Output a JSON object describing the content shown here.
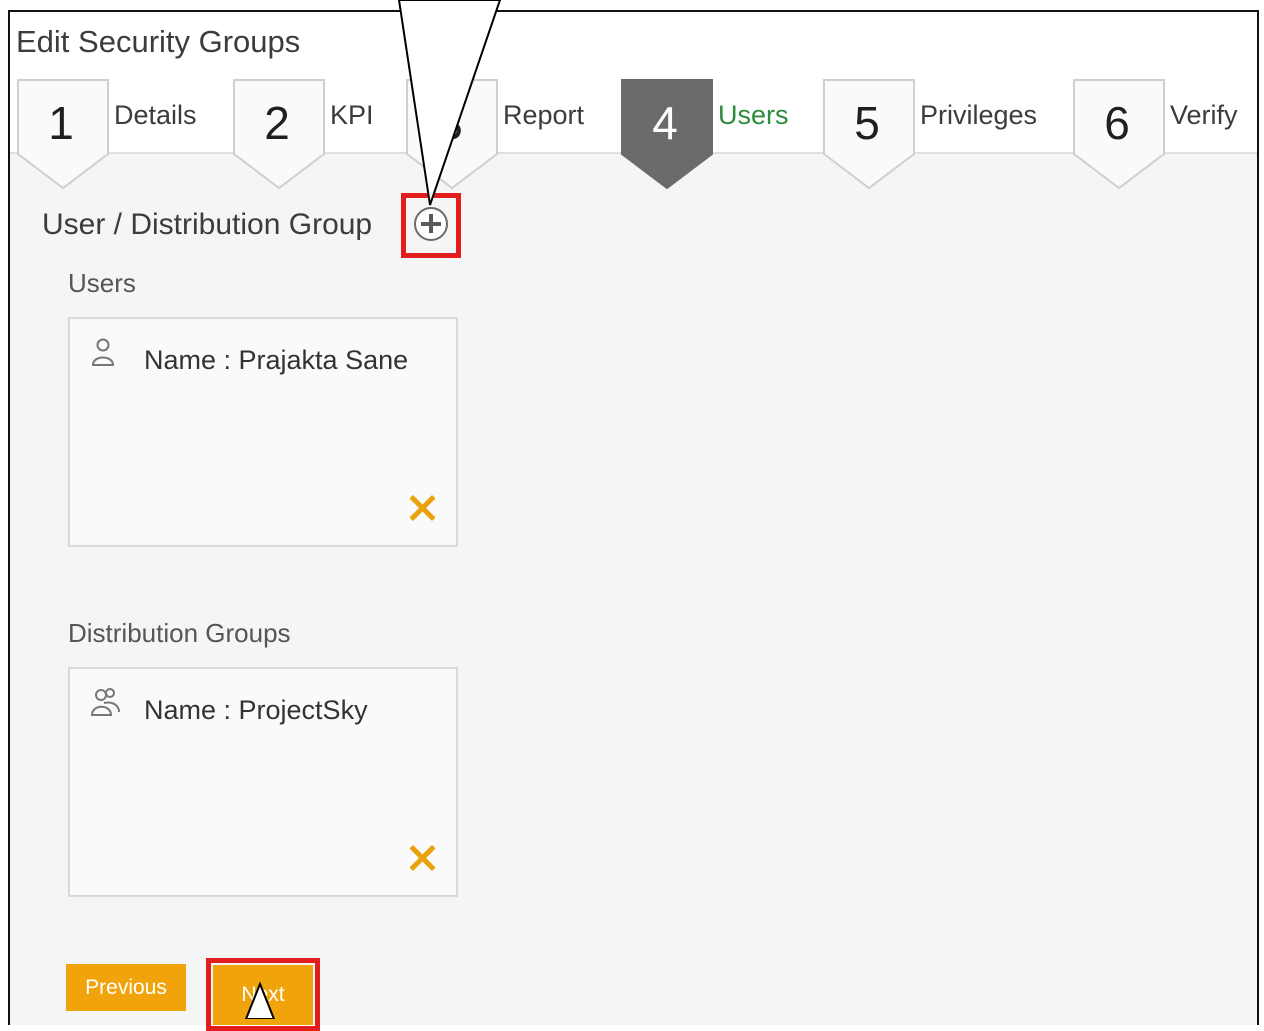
{
  "page": {
    "title": "Edit Security Groups"
  },
  "wizard": {
    "steps": [
      {
        "number": "1",
        "label": "Details",
        "active": false
      },
      {
        "number": "2",
        "label": "KPI",
        "active": false
      },
      {
        "number": "3",
        "label": "Report",
        "active": false
      },
      {
        "number": "4",
        "label": "Users",
        "active": true
      },
      {
        "number": "5",
        "label": "Privileges",
        "active": false
      },
      {
        "number": "6",
        "label": "Verify",
        "active": false
      }
    ]
  },
  "section": {
    "title": "User / Distribution Group"
  },
  "users": {
    "label": "Users",
    "entries": [
      {
        "text": "Name : Prajakta Sane",
        "icon": "user-icon"
      }
    ]
  },
  "distribution_groups": {
    "label": "Distribution Groups",
    "entries": [
      {
        "text": "Name : ProjectSky",
        "icon": "group-icon"
      }
    ]
  },
  "buttons": {
    "previous": "Previous",
    "next": "Next"
  },
  "colors": {
    "accent": "#f0a30a",
    "highlight": "#e21d1d",
    "active_step": "#6b6b6b",
    "active_label": "#2e8b3c",
    "remove_x": "#e9a20c"
  }
}
